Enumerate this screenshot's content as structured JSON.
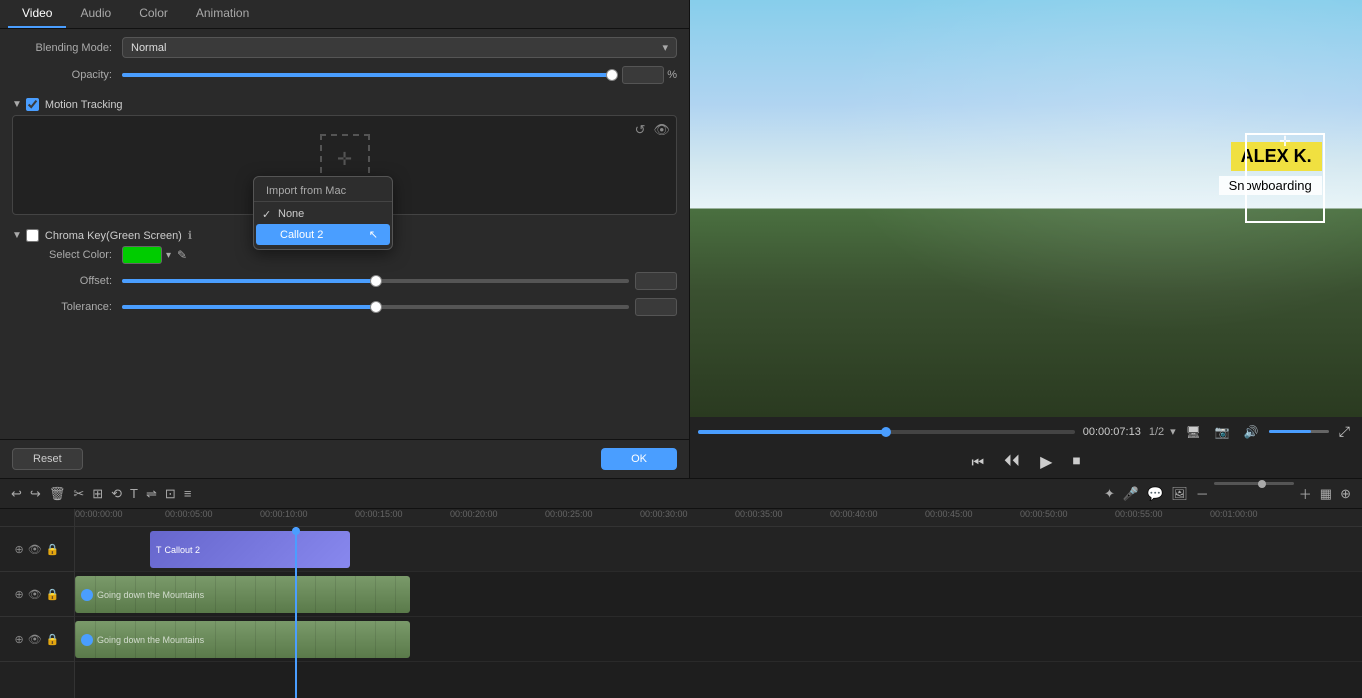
{
  "tabs": {
    "items": [
      {
        "label": "Video",
        "active": true
      },
      {
        "label": "Audio",
        "active": false
      },
      {
        "label": "Color",
        "active": false
      },
      {
        "label": "Animation",
        "active": false
      }
    ]
  },
  "blending": {
    "label": "Blending Mode:",
    "value": "Normal"
  },
  "opacity": {
    "label": "Opacity:",
    "value": "100",
    "unit": "%",
    "fill_pct": 100
  },
  "motion_tracking": {
    "label": "Motion Tracking",
    "enabled": true,
    "dropdown": {
      "header": "Import from Mac",
      "items": [
        {
          "label": "None",
          "checked": true,
          "selected": false
        },
        {
          "label": "Callout 2",
          "checked": false,
          "selected": true
        }
      ]
    }
  },
  "chroma_key": {
    "label": "Chroma Key(Green Screen)",
    "enabled": false,
    "select_color_label": "Select Color:",
    "color": "#00cc00",
    "offset_label": "Offset:",
    "offset_value": "0.0",
    "offset_pct": 50,
    "tolerance_label": "Tolerance:",
    "tolerance_value": "50.0",
    "tolerance_pct": 50
  },
  "buttons": {
    "reset": "Reset",
    "ok": "OK"
  },
  "video_preview": {
    "name_text": "ALEX K.",
    "sport_text": "Snowboarding"
  },
  "playback": {
    "time": "00:00:07:13",
    "ratio": "1/2"
  },
  "timeline": {
    "timestamps": [
      "00:00:00:00",
      "00:00:05:00",
      "00:00:10:00",
      "00:00:15:00",
      "00:00:20:00",
      "00:00:25:00",
      "00:00:30:00",
      "00:00:35:00",
      "00:00:40:00",
      "00:00:45:00",
      "00:00:50:00",
      "00:00:55:00",
      "00:01:00:00"
    ],
    "tracks": [
      {
        "type": "overlay",
        "clip_label": "Callout 2"
      },
      {
        "type": "video",
        "clip_label": "Going down the Mountains"
      },
      {
        "type": "video",
        "clip_label": "Going down the Mountains"
      }
    ]
  }
}
